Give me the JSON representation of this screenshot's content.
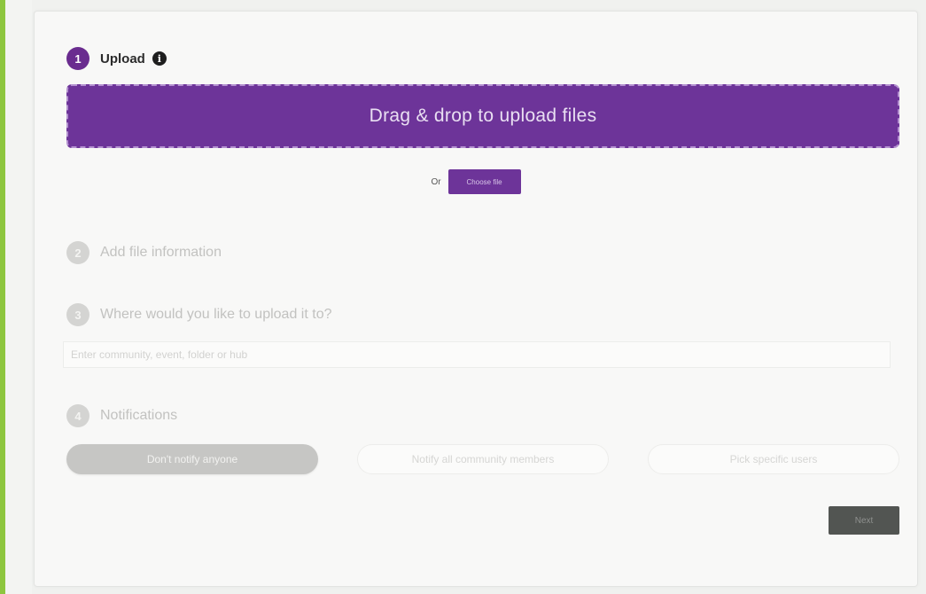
{
  "steps": {
    "upload": {
      "number": "1",
      "label": "Upload",
      "info_icon": "i"
    },
    "file_info": {
      "number": "2",
      "label": "Add file information"
    },
    "destination": {
      "number": "3",
      "label": "Where would you like to upload it to?"
    },
    "notifications": {
      "number": "4",
      "label": "Notifications"
    }
  },
  "dropzone": {
    "label": "Drag & drop to upload files"
  },
  "choose": {
    "or_text": "Or",
    "button_label": "Choose file"
  },
  "destination_input": {
    "placeholder": "Enter community, event, folder or hub"
  },
  "notifications": {
    "options": [
      {
        "label": "Don't notify anyone",
        "selected": true
      },
      {
        "label": "Notify all community members",
        "selected": false
      },
      {
        "label": "Pick specific users",
        "selected": false
      }
    ]
  },
  "next_button": {
    "label": "Next"
  },
  "colors": {
    "accent": "#6d3499",
    "left_bar": "#8dc63f",
    "next_button": "#525552"
  },
  "icons": {
    "info": "info-icon"
  }
}
